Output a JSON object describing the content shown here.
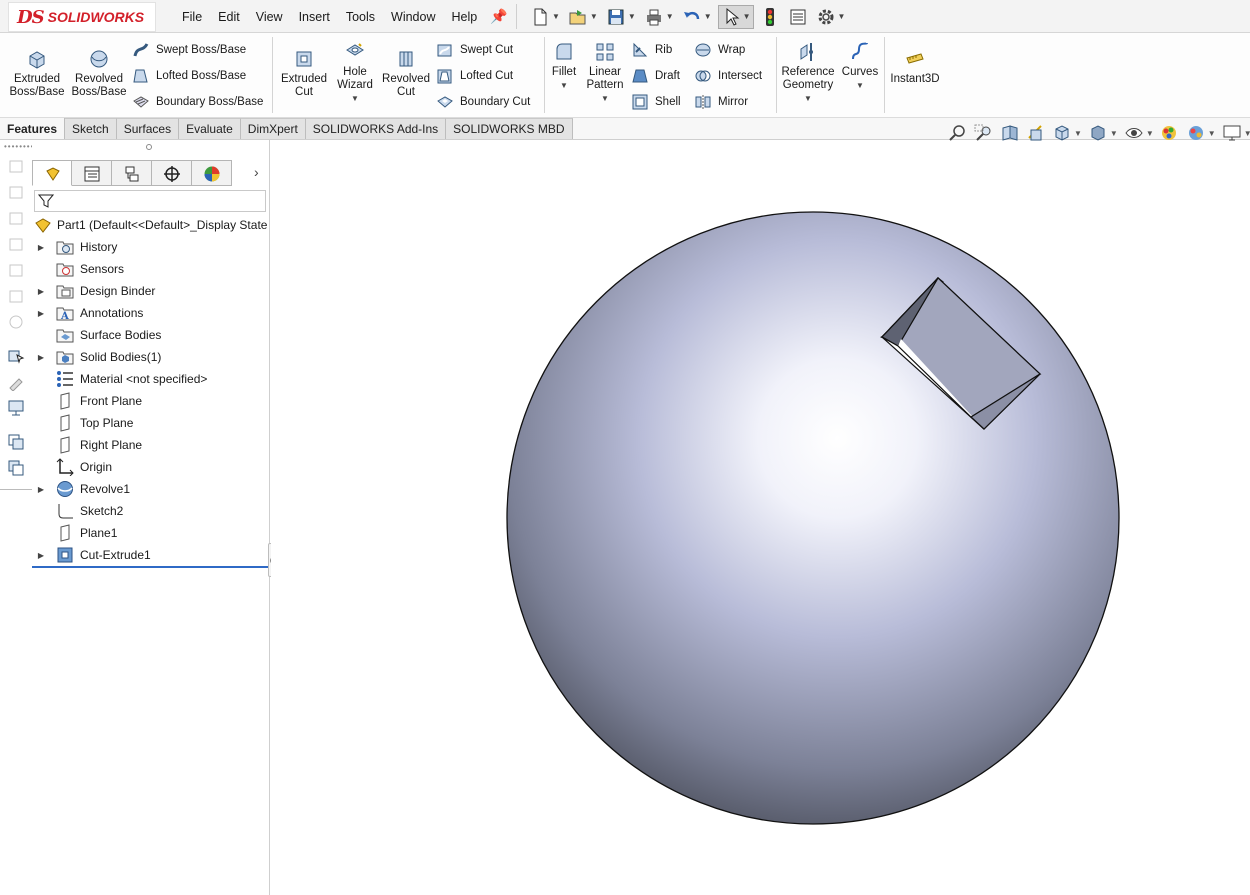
{
  "app": {
    "brand_mark": "DS",
    "brand_name": "SOLIDWORKS"
  },
  "menu": [
    "File",
    "Edit",
    "View",
    "Insert",
    "Tools",
    "Window",
    "Help"
  ],
  "quick_access": [
    "new-icon",
    "open-icon",
    "save-icon",
    "print-icon",
    "undo-icon",
    "select-icon",
    "rebuild-icon",
    "file-properties-icon",
    "options-icon"
  ],
  "command_manager": {
    "extruded_boss": "Extruded\nBoss/Base",
    "revolved_boss": "Revolved\nBoss/Base",
    "swept_boss": "Swept Boss/Base",
    "lofted_boss": "Lofted Boss/Base",
    "boundary_boss": "Boundary Boss/Base",
    "extruded_cut": "Extruded\nCut",
    "hole_wizard": "Hole\nWizard",
    "revolved_cut": "Revolved\nCut",
    "swept_cut": "Swept Cut",
    "lofted_cut": "Lofted Cut",
    "boundary_cut": "Boundary Cut",
    "fillet": "Fillet",
    "linear_pattern": "Linear\nPattern",
    "rib": "Rib",
    "draft": "Draft",
    "shell": "Shell",
    "wrap": "Wrap",
    "intersect": "Intersect",
    "mirror": "Mirror",
    "reference_geometry": "Reference\nGeometry",
    "curves": "Curves",
    "instant3d": "Instant3D"
  },
  "tabs": [
    {
      "label": "Features",
      "active": true
    },
    {
      "label": "Sketch",
      "active": false
    },
    {
      "label": "Surfaces",
      "active": false
    },
    {
      "label": "Evaluate",
      "active": false
    },
    {
      "label": "DimXpert",
      "active": false
    },
    {
      "label": "SOLIDWORKS Add-Ins",
      "active": false
    },
    {
      "label": "SOLIDWORKS MBD",
      "active": false
    }
  ],
  "feature_tree": {
    "root": "Part1  (Default<<Default>_Display State",
    "items": [
      {
        "label": "History",
        "icon": "history-folder-icon",
        "expandable": true
      },
      {
        "label": "Sensors",
        "icon": "sensors-folder-icon",
        "expandable": false
      },
      {
        "label": "Design Binder",
        "icon": "design-binder-icon",
        "expandable": true
      },
      {
        "label": "Annotations",
        "icon": "annotations-icon",
        "expandable": true
      },
      {
        "label": "Surface Bodies",
        "icon": "surface-bodies-icon",
        "expandable": false
      },
      {
        "label": "Solid Bodies(1)",
        "icon": "solid-bodies-icon",
        "expandable": true
      },
      {
        "label": "Material <not specified>",
        "icon": "material-icon",
        "expandable": false
      },
      {
        "label": "Front Plane",
        "icon": "plane-icon",
        "expandable": false
      },
      {
        "label": "Top Plane",
        "icon": "plane-icon",
        "expandable": false
      },
      {
        "label": "Right Plane",
        "icon": "plane-icon",
        "expandable": false
      },
      {
        "label": "Origin",
        "icon": "origin-icon",
        "expandable": false
      },
      {
        "label": "Revolve1",
        "icon": "revolve-icon",
        "expandable": true
      },
      {
        "label": "Sketch2",
        "icon": "sketch-icon",
        "expandable": false
      },
      {
        "label": "Plane1",
        "icon": "plane-icon",
        "expandable": false
      },
      {
        "label": "Cut-Extrude1",
        "icon": "cut-extrude-icon",
        "expandable": true
      }
    ]
  },
  "colors": {
    "brand_red": "#d3202a",
    "accent_blue": "#2f6ac6",
    "sphere_light": "#ffffff",
    "sphere_mid": "#a9aecb",
    "sphere_dark": "#414550"
  }
}
